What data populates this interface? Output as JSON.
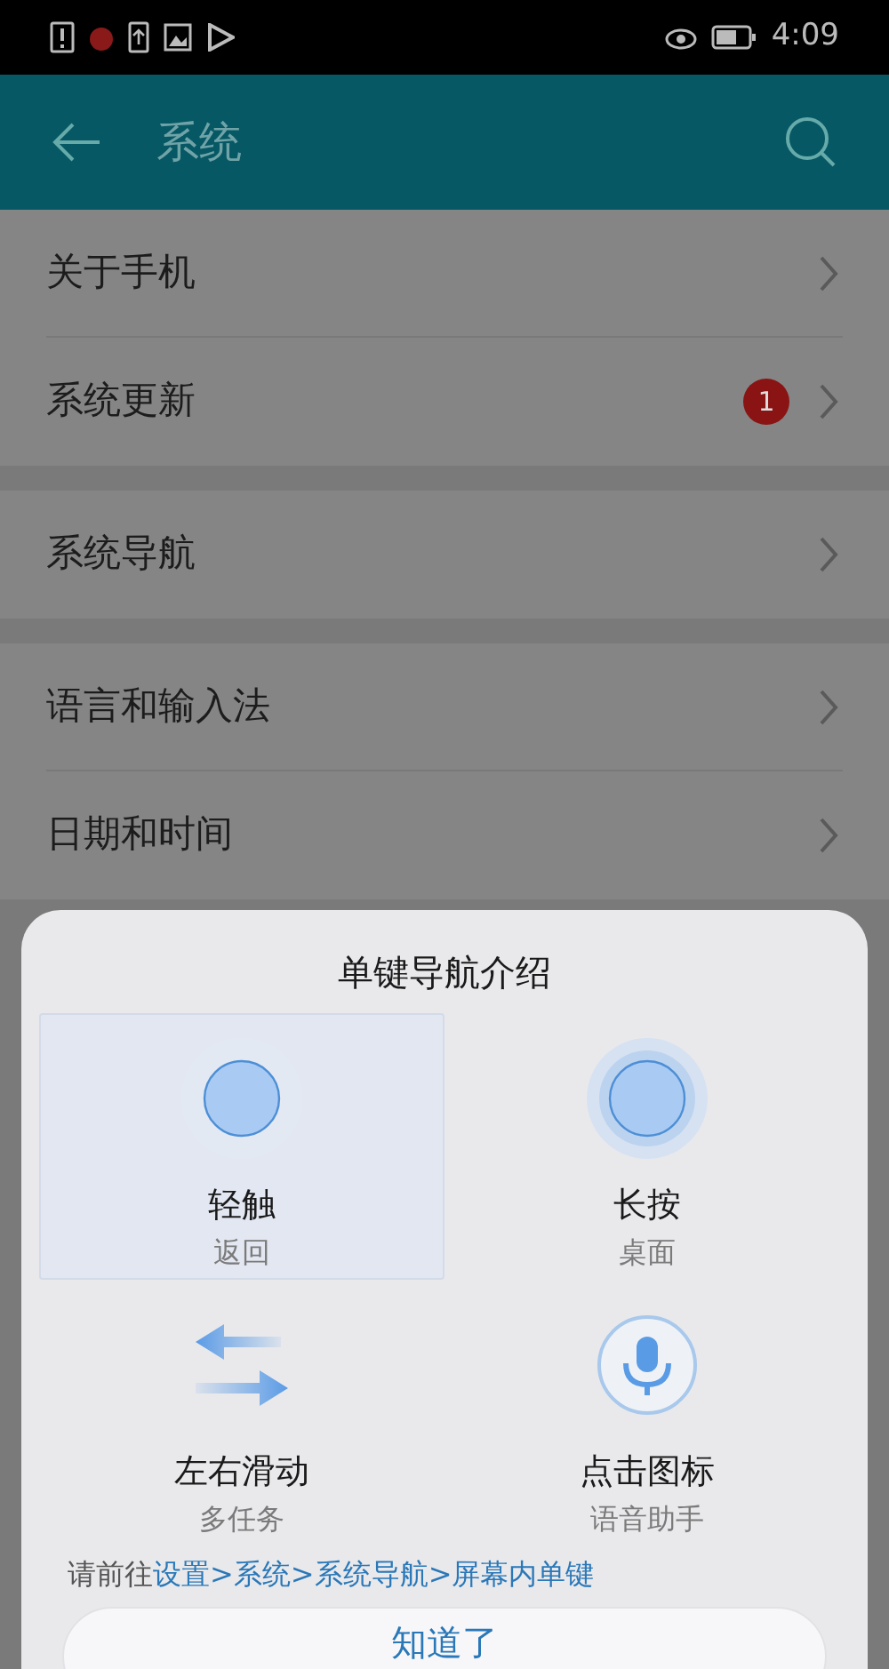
{
  "status_bar": {
    "time": "4:09"
  },
  "header": {
    "title": "系统"
  },
  "settings_groups": [
    [
      {
        "label": "关于手机"
      },
      {
        "label": "系统更新",
        "badge": "1"
      }
    ],
    [
      {
        "label": "系统导航"
      }
    ],
    [
      {
        "label": "语言和输入法"
      },
      {
        "label": "日期和时间"
      }
    ]
  ],
  "dialog": {
    "title": "单键导航介绍",
    "gestures": [
      {
        "kind": "tap",
        "label": "轻触",
        "action": "返回",
        "selected": true
      },
      {
        "kind": "press",
        "label": "长按",
        "action": "桌面",
        "selected": false
      },
      {
        "kind": "swipe",
        "label": "左右滑动",
        "action": "多任务",
        "selected": false
      },
      {
        "kind": "mic",
        "label": "点击图标",
        "action": "语音助手",
        "selected": false
      }
    ],
    "hint": {
      "prefix": "请前往",
      "path": "设置>系统>系统导航>屏幕内单键"
    },
    "button": "知道了"
  }
}
